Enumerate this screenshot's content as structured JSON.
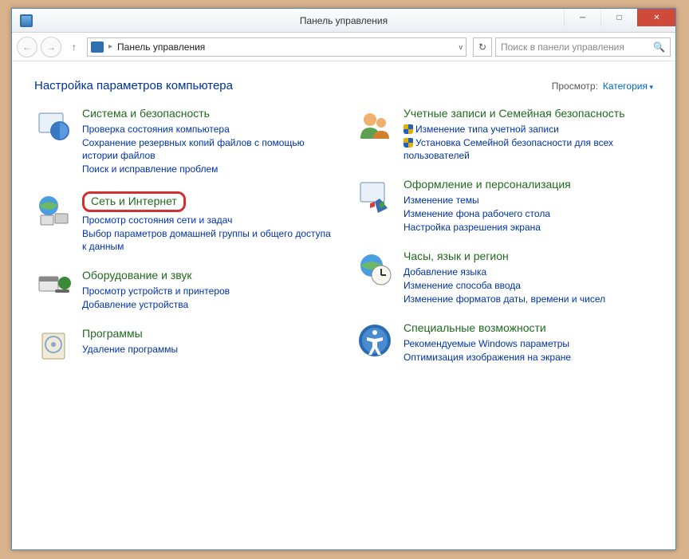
{
  "window": {
    "title": "Панель управления"
  },
  "nav": {
    "breadcrumb": "Панель управления",
    "search_placeholder": "Поиск в панели управления"
  },
  "header": {
    "heading": "Настройка параметров компьютера",
    "view_label": "Просмотр:",
    "view_value": "Категория"
  },
  "left": [
    {
      "icon": "system-security",
      "title": "Система и безопасность",
      "links": [
        {
          "text": "Проверка состояния компьютера"
        },
        {
          "text": "Сохранение резервных копий файлов с помощью истории файлов"
        },
        {
          "text": "Поиск и исправление проблем"
        }
      ]
    },
    {
      "icon": "network",
      "title": "Сеть и Интернет",
      "highlight": true,
      "links": [
        {
          "text": "Просмотр состояния сети и задач"
        },
        {
          "text": "Выбор параметров домашней группы и общего доступа к данным"
        }
      ]
    },
    {
      "icon": "hardware",
      "title": "Оборудование и звук",
      "links": [
        {
          "text": "Просмотр устройств и принтеров"
        },
        {
          "text": "Добавление устройства"
        }
      ]
    },
    {
      "icon": "programs",
      "title": "Программы",
      "links": [
        {
          "text": "Удаление программы"
        }
      ]
    }
  ],
  "right": [
    {
      "icon": "users",
      "title": "Учетные записи и Семейная безопасность",
      "links": [
        {
          "text": "Изменение типа учетной записи",
          "shield": true
        },
        {
          "text": "Установка Семейной безопасности для всех пользователей",
          "shield": true
        }
      ]
    },
    {
      "icon": "appearance",
      "title": "Оформление и персонализация",
      "links": [
        {
          "text": "Изменение темы"
        },
        {
          "text": "Изменение фона рабочего стола"
        },
        {
          "text": "Настройка разрешения экрана"
        }
      ]
    },
    {
      "icon": "clock-region",
      "title": "Часы, язык и регион",
      "links": [
        {
          "text": "Добавление языка"
        },
        {
          "text": "Изменение способа ввода"
        },
        {
          "text": "Изменение форматов даты, времени и чисел"
        }
      ]
    },
    {
      "icon": "accessibility",
      "title": "Специальные возможности",
      "links": [
        {
          "text": "Рекомендуемые Windows параметры"
        },
        {
          "text": "Оптимизация изображения на экране"
        }
      ]
    }
  ]
}
